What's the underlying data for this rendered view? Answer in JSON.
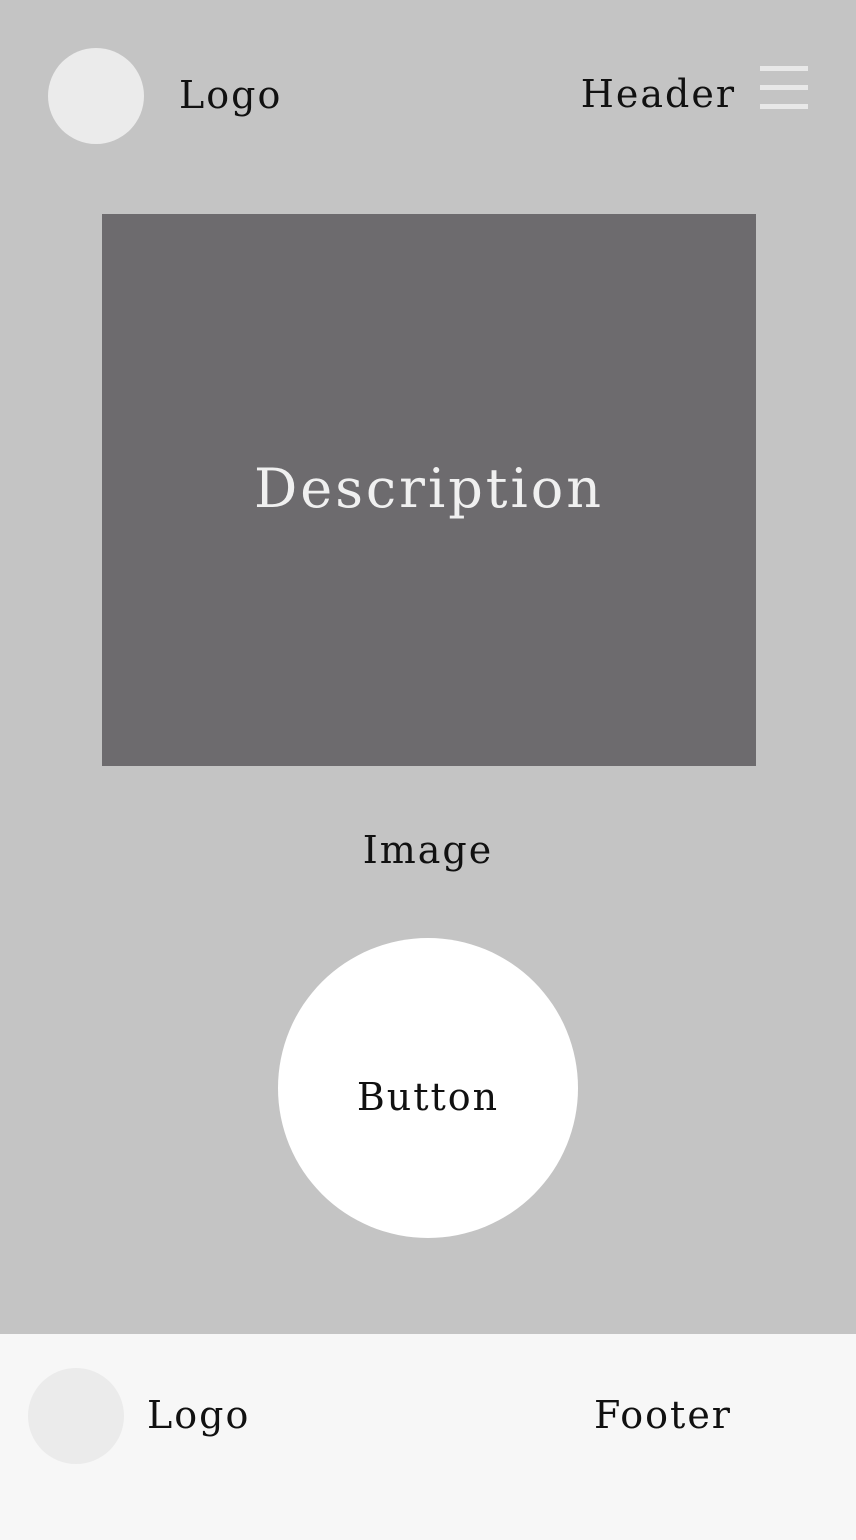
{
  "header": {
    "logo_text": "Logo",
    "title": "Header",
    "menu_icon": "hamburger-menu-icon"
  },
  "main": {
    "image_description": "Description",
    "image_caption": "Image",
    "button_label": "Button"
  },
  "footer": {
    "logo_text": "Logo",
    "title": "Footer"
  },
  "colors": {
    "page_background": "#c4c4c4",
    "image_placeholder": "#6d6b6e",
    "footer_background": "#f7f7f7",
    "logo_placeholder": "#ebebeb",
    "button_background": "#ffffff"
  }
}
